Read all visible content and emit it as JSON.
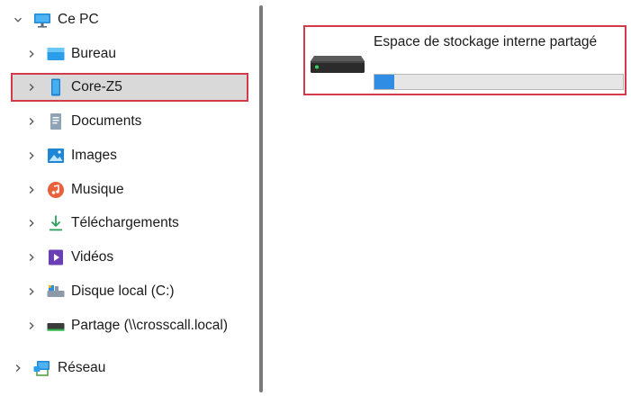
{
  "tree": {
    "root": {
      "label": "Ce PC",
      "icon": "monitor-icon",
      "expanded": true
    },
    "items": [
      {
        "id": "bureau",
        "label": "Bureau",
        "icon": "desktop-folder-icon"
      },
      {
        "id": "core-z5",
        "label": "Core-Z5",
        "icon": "phone-icon",
        "selected": true
      },
      {
        "id": "documents",
        "label": "Documents",
        "icon": "document-icon"
      },
      {
        "id": "images",
        "label": "Images",
        "icon": "image-icon"
      },
      {
        "id": "musique",
        "label": "Musique",
        "icon": "music-icon"
      },
      {
        "id": "telechargements",
        "label": "Téléchargements",
        "icon": "download-icon"
      },
      {
        "id": "videos",
        "label": "Vidéos",
        "icon": "video-icon"
      },
      {
        "id": "disque-local",
        "label": "Disque local (C:)",
        "icon": "local-disk-icon"
      },
      {
        "id": "partage",
        "label": "Partage (\\\\crosscall.local)",
        "icon": "network-drive-icon"
      }
    ],
    "network": {
      "label": "Réseau",
      "icon": "network-icon"
    }
  },
  "content": {
    "drive": {
      "name": "Espace de stockage interne partagé",
      "usage_fraction": 0.08,
      "icon": "hard-drive-icon"
    }
  },
  "colors": {
    "highlight_border": "#d33a4a",
    "selected_bg": "#d9d9d9",
    "usage_fill": "#2f8ee3"
  }
}
